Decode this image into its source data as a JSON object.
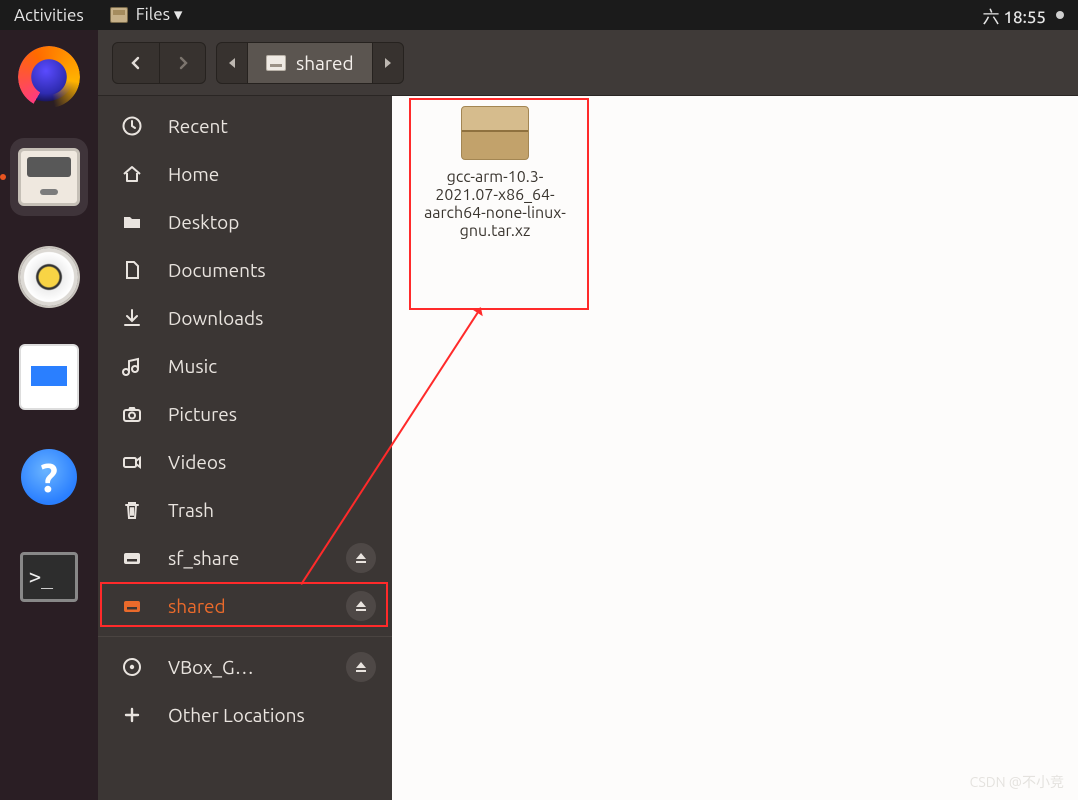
{
  "topbar": {
    "activities": "Activities",
    "app_label": "Files ▾",
    "clock": "六 18:55"
  },
  "dock": {
    "help_glyph": "?",
    "term_glyph": ">_"
  },
  "header": {
    "crumb_label": "shared"
  },
  "sidebar": {
    "items": [
      {
        "label": "Recent"
      },
      {
        "label": "Home"
      },
      {
        "label": "Desktop"
      },
      {
        "label": "Documents"
      },
      {
        "label": "Downloads"
      },
      {
        "label": "Music"
      },
      {
        "label": "Pictures"
      },
      {
        "label": "Videos"
      },
      {
        "label": "Trash"
      },
      {
        "label": "sf_share"
      },
      {
        "label": "shared"
      },
      {
        "label": "VBox_G…"
      },
      {
        "label": "Other Locations"
      }
    ]
  },
  "files": [
    {
      "name": "gcc-arm-10.3-2021.07-x86_64-aarch64-none-linux-gnu.tar.xz"
    }
  ],
  "watermark": "CSDN @不小竞"
}
